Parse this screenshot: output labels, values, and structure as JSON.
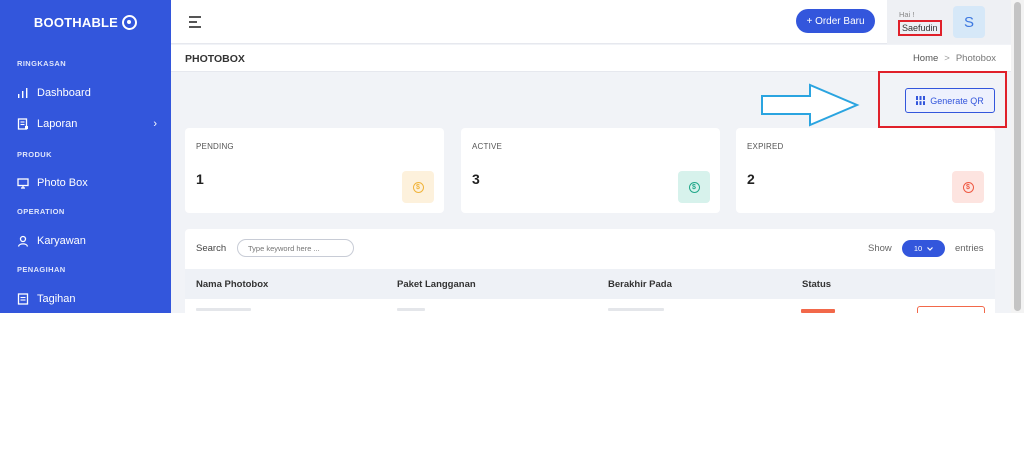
{
  "brand": {
    "name": "BOOTHABLE"
  },
  "sidebar": {
    "sections": [
      {
        "title": "RINGKASAN"
      },
      {
        "title": "PRODUK"
      },
      {
        "title": "OPERATION"
      },
      {
        "title": "PENAGIHAN"
      }
    ],
    "items": [
      {
        "label": "Dashboard",
        "icon": "bar-chart-icon"
      },
      {
        "label": "Laporan",
        "icon": "report-icon",
        "chevron": "›"
      },
      {
        "label": "Photo Box",
        "icon": "monitor-icon"
      },
      {
        "label": "Karyawan",
        "icon": "user-icon"
      },
      {
        "label": "Tagihan",
        "icon": "invoice-icon"
      }
    ]
  },
  "topbar": {
    "order_button": "+ Order Baru",
    "greeting": "Hai !",
    "username": "Saefudin",
    "avatar_initial": "S"
  },
  "page": {
    "title": "PHOTOBOX",
    "breadcrumb": {
      "home": "Home",
      "separator": ">",
      "current": "Photobox"
    }
  },
  "actions": {
    "generate_qr": "Generate QR"
  },
  "stats": [
    {
      "label": "PENDING",
      "value": "1",
      "icon_symbol": "$",
      "color": "#f0b43c",
      "bg": "#fdf1dc"
    },
    {
      "label": "ACTIVE",
      "value": "3",
      "icon_symbol": "$",
      "color": "#22a88a",
      "bg": "#d7f2ec"
    },
    {
      "label": "EXPIRED",
      "value": "2",
      "icon_symbol": "$",
      "color": "#ef5a44",
      "bg": "#fde4e0"
    }
  ],
  "table": {
    "search_label": "Search",
    "search_placeholder": "Type keyword here ...",
    "show_label": "Show",
    "entries_value": "10",
    "entries_label": "entries",
    "columns": [
      "Nama Photobox",
      "Paket Langganan",
      "Berakhir Pada",
      "Status"
    ]
  },
  "colors": {
    "primary": "#3356dc",
    "highlight": "#e0202a",
    "arrow": "#2aa4e0"
  }
}
